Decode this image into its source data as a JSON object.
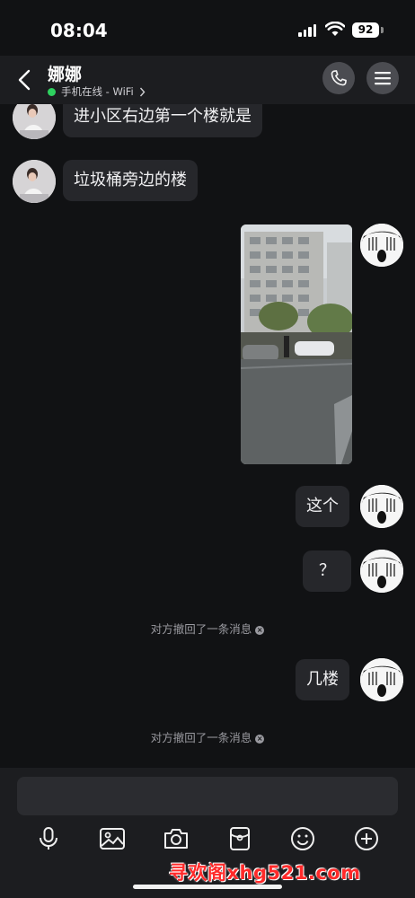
{
  "status_bar": {
    "time": "08:04",
    "battery": "92"
  },
  "header": {
    "contact_name": "娜娜",
    "presence": "手机在线 - WiFi"
  },
  "messages": [
    {
      "side": "left",
      "text": "进小区右边第一个楼就是"
    },
    {
      "side": "left",
      "text": "垃圾桶旁边的楼"
    },
    {
      "side": "right",
      "type": "image"
    },
    {
      "side": "right",
      "text": "这个"
    },
    {
      "side": "right",
      "text": "？"
    },
    {
      "type": "notice",
      "text": "对方撤回了一条消息"
    },
    {
      "side": "right",
      "text": "几楼"
    },
    {
      "type": "notice",
      "text": "对方撤回了一条消息"
    }
  ],
  "watermark": "寻欢阁xhg521.com",
  "icons": {
    "back": "chevron-left-icon",
    "call": "phone-icon",
    "menu": "hamburger-icon",
    "toolbar": [
      "microphone-icon",
      "image-icon",
      "camera-icon",
      "red-packet-icon",
      "emoji-icon",
      "plus-icon"
    ]
  },
  "colors": {
    "online": "#2ed15f",
    "bubble": "#26272b",
    "background": "#111214"
  }
}
